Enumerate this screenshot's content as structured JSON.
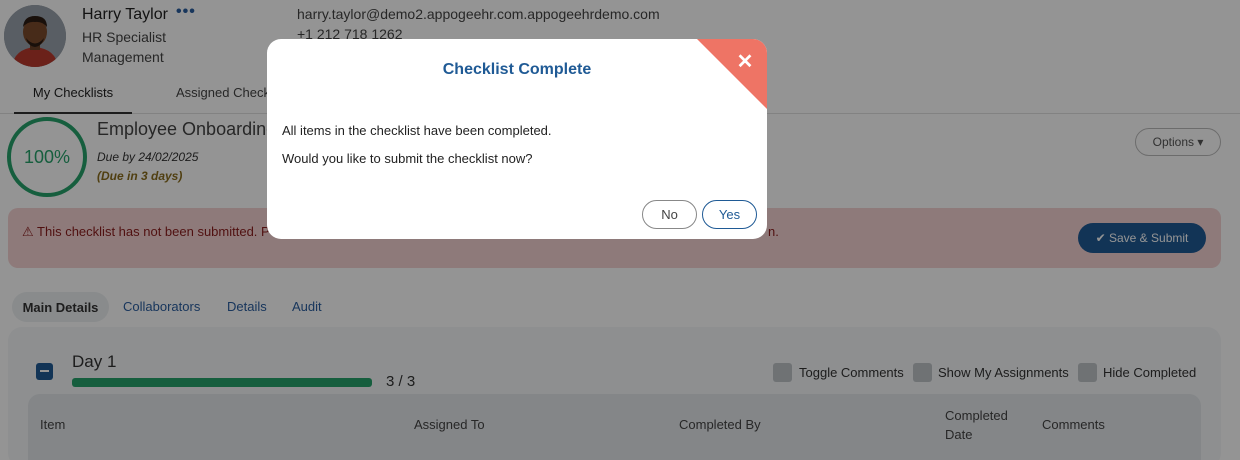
{
  "user": {
    "name": "Harry Taylor",
    "more_icon": "more-dots-icon",
    "role": "HR Specialist",
    "department": "Management",
    "email": "harry.taylor@demo2.appogeehr.com.appogeehrdemo.com",
    "phone": "+1 212 718 1262"
  },
  "top_tabs": [
    {
      "label": "My Checklists",
      "active": true
    },
    {
      "label": "Assigned Check",
      "active": false
    }
  ],
  "checklist": {
    "progress_label": "100%",
    "progress_fraction": 1.0,
    "title": "Employee Onboarding",
    "due": "Due by 24/02/2025",
    "due_relative": "(Due in 3 days)",
    "options_label": "Options ▾"
  },
  "alert": {
    "icon": "warning-icon",
    "text": "⚠ This checklist has not been submitted. P",
    "tail": "n.",
    "submit_label": "✔ Save & Submit"
  },
  "sub_tabs": [
    {
      "label": "Main Details",
      "active": true
    },
    {
      "label": "Collaborators",
      "active": false
    },
    {
      "label": "Details",
      "active": false
    },
    {
      "label": "Audit",
      "active": false
    }
  ],
  "section": {
    "title": "Day 1",
    "count": "3 / 3",
    "progress_fraction": 1.0,
    "toggles": {
      "toggle_comments": "Toggle Comments",
      "show_my_assignments": "Show My Assignments",
      "hide_completed": "Hide Completed"
    },
    "columns": {
      "item": "Item",
      "assigned_to": "Assigned To",
      "completed_by": "Completed By",
      "completed": "Completed",
      "date": "Date",
      "comments": "Comments"
    }
  },
  "modal": {
    "title": "Checklist Complete",
    "close_icon": "✕",
    "line1": "All items in the checklist have been completed.",
    "line2": "Would you like to submit the checklist now?",
    "no_label": "No",
    "yes_label": "Yes",
    "corner_color": "#ee7465"
  },
  "colors": {
    "accent": "#1f5a95",
    "success": "#27a36b",
    "alert_bg": "#f5d2d2"
  }
}
